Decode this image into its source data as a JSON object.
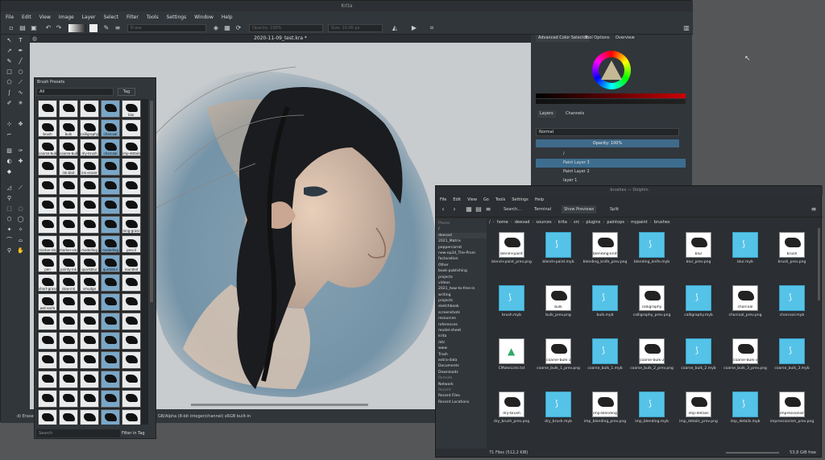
{
  "krita": {
    "title": "Krita",
    "menu": [
      "File",
      "Edit",
      "View",
      "Image",
      "Layer",
      "Select",
      "Filter",
      "Tools",
      "Settings",
      "Window",
      "Help"
    ],
    "toolbar": {
      "blend_mode": "Erase",
      "opacity": "Opacity: 100%",
      "size": "Size: 10.00 px"
    },
    "document_tab": "2020-11-09_test.kra *",
    "status": {
      "left": "d) Eraser",
      "color": "GB/Alpha (8-bit integer/channel)  sRGB built-in"
    },
    "docker_tabs": [
      "Advanced Color Selector",
      "Tool Options",
      "Overview"
    ],
    "layers_tabs": [
      "Layers",
      "Channels"
    ],
    "layers": {
      "blend": "Normal",
      "opacity": "Opacity: 100%",
      "items": [
        {
          "name": "/"
        },
        {
          "name": "Paint Layer 3",
          "selected": true
        },
        {
          "name": "Paint Layer 2"
        },
        {
          "name": "layer 1"
        }
      ]
    },
    "brush_presets": {
      "title": "Brush Presets",
      "filter": "All",
      "tag_button": "Tag",
      "search_placeholder": "Search",
      "filter_in_tag": "Filter in Tag",
      "labels": [
        "",
        "",
        "",
        "",
        "blur",
        "brush",
        "bulk",
        "calligraphy",
        "charcoal",
        "",
        "coarse-bulk-1",
        "coarse-bulk-2",
        "dry-brush",
        "charcoal",
        "imp-details",
        "",
        "ink-blot",
        "ink-eraser",
        "",
        "",
        "",
        "",
        "",
        "",
        "",
        "",
        "",
        "",
        "",
        "",
        "",
        "",
        "",
        "",
        "long-grass",
        "marker-ink",
        "marker-small",
        "modelling",
        "modelling",
        "pencil",
        "pen",
        "pointy-ink",
        "quarkblur",
        "quickblur",
        "rounded",
        "short-grass",
        "slow-ink",
        "smudge",
        "",
        "",
        "wet-knife"
      ]
    }
  },
  "dolphin": {
    "title": "brushes — Dolphin",
    "menu": [
      "File",
      "Edit",
      "View",
      "Go",
      "Tools",
      "Settings",
      "Help"
    ],
    "toolbar": {
      "search": "Search...",
      "terminal": "Terminal",
      "show_previews": "Show Previews",
      "split": "Split"
    },
    "places": [
      {
        "label": "Places",
        "hdr": true
      },
      {
        "label": "/"
      },
      {
        "label": "deevad",
        "selected": true
      },
      {
        "label": "2021_Matrix"
      },
      {
        "label": "peppercarrot"
      },
      {
        "label": "new-ep34_The-Prom"
      },
      {
        "label": "facturation"
      },
      {
        "label": "Other"
      },
      {
        "label": "book-publishing"
      },
      {
        "label": "projects"
      },
      {
        "label": "videos"
      },
      {
        "label": "2021_how-to-free-in"
      },
      {
        "label": "writing"
      },
      {
        "label": "projects"
      },
      {
        "label": "sketchbook"
      },
      {
        "label": "screenshots"
      },
      {
        "label": "resources"
      },
      {
        "label": "references"
      },
      {
        "label": "model-sheet"
      },
      {
        "label": "krita"
      },
      {
        "label": "/etc"
      },
      {
        "label": "www"
      },
      {
        "label": "Trash"
      },
      {
        "label": "extra-data"
      },
      {
        "label": "Documents"
      },
      {
        "label": "Downloads"
      },
      {
        "label": "Remote",
        "hdr": true
      },
      {
        "label": "Network"
      },
      {
        "label": "Recent",
        "hdr": true
      },
      {
        "label": "Recent Files"
      },
      {
        "label": "Recent Locations"
      }
    ],
    "breadcrumb": [
      "/",
      "home",
      "deevad",
      "sources",
      "krita",
      "src",
      "plugins",
      "paintops",
      "mypaint",
      "brushes"
    ],
    "files": [
      {
        "name": "blend+paint_prev.png",
        "type": "img",
        "label": "blend+paint"
      },
      {
        "name": "blend+paint.myb",
        "type": "myb"
      },
      {
        "name": "blending_knife_prev.png",
        "type": "img",
        "label": "blending-knife"
      },
      {
        "name": "blending_knife.myb",
        "type": "myb"
      },
      {
        "name": "blur_prev.png",
        "type": "img",
        "label": "blur"
      },
      {
        "name": "blur.myb",
        "type": "myb"
      },
      {
        "name": "brush_prev.png",
        "type": "img",
        "label": "brush"
      },
      {
        "name": "brush.myb",
        "type": "myb"
      },
      {
        "name": "bulk_prev.png",
        "type": "img",
        "label": "bulk"
      },
      {
        "name": "bulk.myb",
        "type": "myb"
      },
      {
        "name": "calligraphy_prev.png",
        "type": "img",
        "label": "calligraphy"
      },
      {
        "name": "calligraphy.myb",
        "type": "myb"
      },
      {
        "name": "charcoal_prev.png",
        "type": "img",
        "label": "charcoal"
      },
      {
        "name": "charcoal.myb",
        "type": "myb"
      },
      {
        "name": "CMakeLists.txt",
        "type": "txt"
      },
      {
        "name": "coarse_bulk_1_prev.png",
        "type": "img",
        "label": "coarse-bulk-1"
      },
      {
        "name": "coarse_bulk_1.myb",
        "type": "myb"
      },
      {
        "name": "coarse_bulk_2_prev.png",
        "type": "img",
        "label": "coarse-bulk-2"
      },
      {
        "name": "coarse_bulk_2.myb",
        "type": "myb"
      },
      {
        "name": "coarse_bulk_3_prev.png",
        "type": "img",
        "label": "coarse-bulk-3"
      },
      {
        "name": "coarse_bulk_3.myb",
        "type": "myb"
      },
      {
        "name": "dry_brush_prev.png",
        "type": "img",
        "label": "dry-brush"
      },
      {
        "name": "dry_brush.myb",
        "type": "myb"
      },
      {
        "name": "imp_blending_prev.png",
        "type": "img",
        "label": "imp-blending"
      },
      {
        "name": "imp_blending.myb",
        "type": "myb"
      },
      {
        "name": "imp_details_prev.png",
        "type": "img",
        "label": "imp-details"
      },
      {
        "name": "imp_details.myb",
        "type": "myb"
      },
      {
        "name": "impressionism_prev.png",
        "type": "img",
        "label": "impressionism"
      }
    ],
    "status": "71 Files (512,2 KiB)",
    "free": "53,8 GiB free",
    "colors": {
      "myb": "#55c3e8",
      "selected": "#3daee9"
    }
  }
}
